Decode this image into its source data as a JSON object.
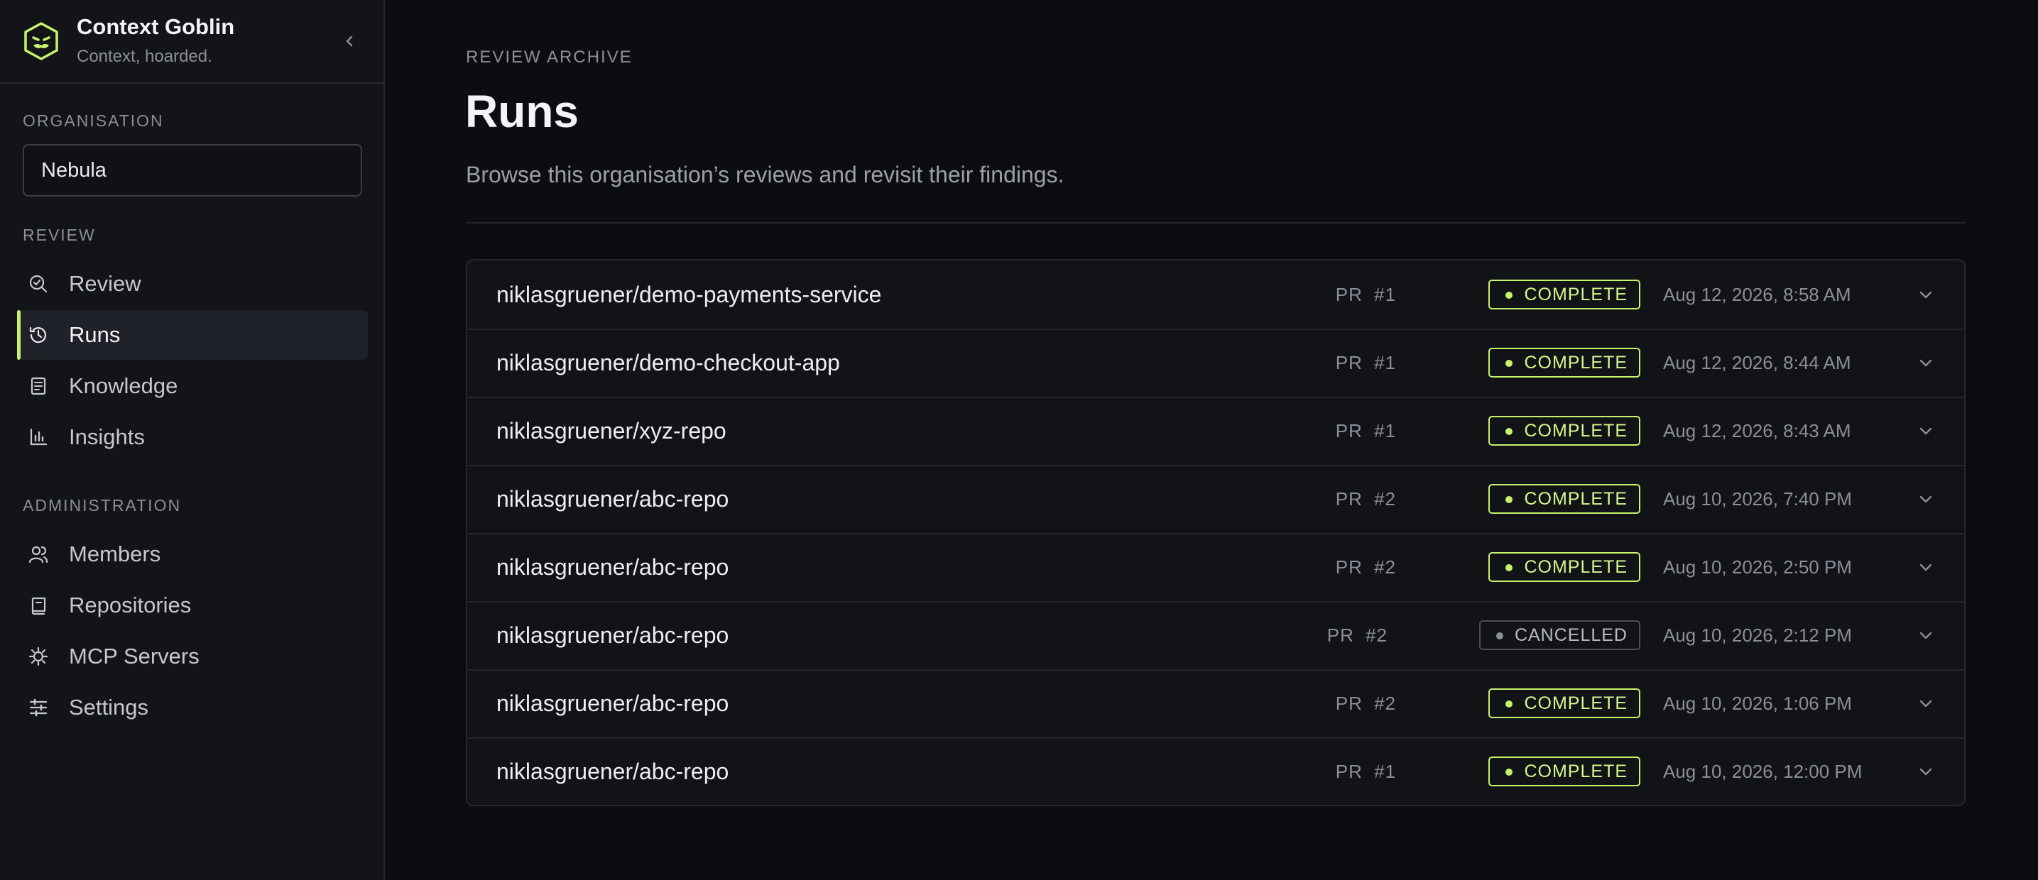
{
  "brand": {
    "name": "Context Goblin",
    "tagline": "Context, hoarded."
  },
  "sidebar": {
    "org_label": "ORGANISATION",
    "org_value": "Nebula",
    "review_label": "REVIEW",
    "review_items": [
      {
        "label": "Review",
        "icon": "search-check-icon"
      },
      {
        "label": "Runs",
        "icon": "history-icon",
        "active": true
      },
      {
        "label": "Knowledge",
        "icon": "book-icon"
      },
      {
        "label": "Insights",
        "icon": "bar-chart-icon"
      }
    ],
    "admin_label": "ADMINISTRATION",
    "admin_items": [
      {
        "label": "Members",
        "icon": "users-icon"
      },
      {
        "label": "Repositories",
        "icon": "repo-book-icon"
      },
      {
        "label": "MCP Servers",
        "icon": "bug-icon"
      },
      {
        "label": "Settings",
        "icon": "sliders-icon"
      }
    ]
  },
  "main": {
    "eyebrow": "REVIEW ARCHIVE",
    "title": "Runs",
    "description": "Browse this organisation’s reviews and revisit their findings."
  },
  "runs": [
    {
      "repo": "niklasgruener/demo-payments-service",
      "pr": "PR  #1",
      "status": "COMPLETE",
      "date": "Aug 12, 2026, 8:58 AM"
    },
    {
      "repo": "niklasgruener/demo-checkout-app",
      "pr": "PR  #1",
      "status": "COMPLETE",
      "date": "Aug 12, 2026, 8:44 AM"
    },
    {
      "repo": "niklasgruener/xyz-repo",
      "pr": "PR  #1",
      "status": "COMPLETE",
      "date": "Aug 12, 2026, 8:43 AM"
    },
    {
      "repo": "niklasgruener/abc-repo",
      "pr": "PR  #2",
      "status": "COMPLETE",
      "date": "Aug 10, 2026, 7:40 PM"
    },
    {
      "repo": "niklasgruener/abc-repo",
      "pr": "PR  #2",
      "status": "COMPLETE",
      "date": "Aug 10, 2026, 2:50 PM"
    },
    {
      "repo": "niklasgruener/abc-repo",
      "pr": "PR  #2",
      "status": "CANCELLED",
      "date": "Aug 10, 2026, 2:12 PM"
    },
    {
      "repo": "niklasgruener/abc-repo",
      "pr": "PR  #2",
      "status": "COMPLETE",
      "date": "Aug 10, 2026, 1:06 PM"
    },
    {
      "repo": "niklasgruener/abc-repo",
      "pr": "PR  #1",
      "status": "COMPLETE",
      "date": "Aug 10, 2026, 12:00 PM"
    }
  ],
  "colors": {
    "accent": "#c6f36b",
    "background": "#0c0d10",
    "sidebar": "#121418"
  }
}
